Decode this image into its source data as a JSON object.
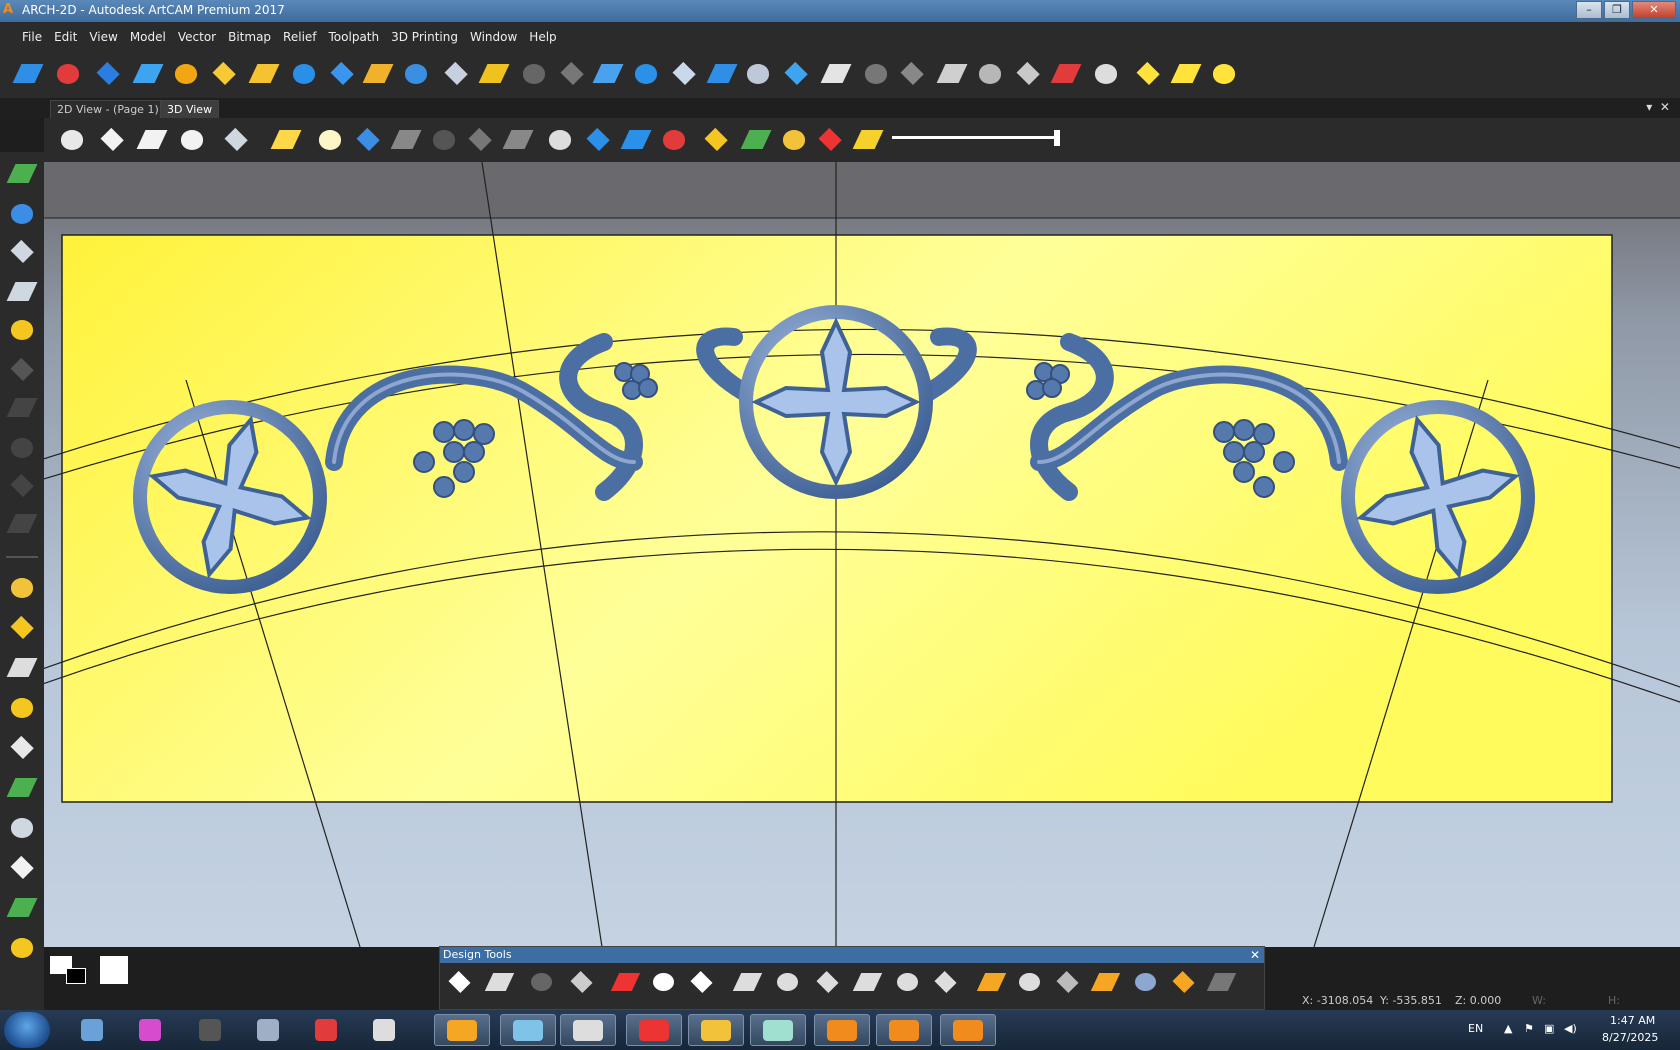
{
  "window": {
    "title": "ARCH-2D - Autodesk ArtCAM Premium 2017"
  },
  "menu": [
    "File",
    "Edit",
    "View",
    "Model",
    "Vector",
    "Bitmap",
    "Relief",
    "Toolpath",
    "3D Printing",
    "Window",
    "Help"
  ],
  "tabs": [
    {
      "label": "2D View -  (Page 1)",
      "active": false
    },
    {
      "label": "3D View",
      "active": true
    }
  ],
  "toolbar1_icons": [
    "plane-icon",
    "revolve-icon",
    "extrude-icon",
    "spin-icon",
    "weave-icon",
    "sculpt-icon",
    "import-folder-icon",
    "flat-relief-icon",
    "split-relief-icon",
    "texture-icon",
    "raise-icon",
    "merge-icon",
    "peak-icon",
    "smooth-icon",
    "dots-icon",
    "fade-icon",
    "layers-icon",
    "offset-icon",
    "blend-icon",
    "distort-icon",
    "stack-icon",
    "eraser-icon",
    "tilt-icon",
    "colors-grid-icon",
    "scale-icon",
    "mirror-icon",
    "tiles-icon",
    "flag-icon",
    "cross-section-icon",
    "node-icon",
    "wave-icon",
    "polyline-icon"
  ],
  "toolbar2_icons": [
    "view-iso-red-icon",
    "view-front-icon",
    "view-side-icon",
    "view-top-icon",
    "zoom-icon",
    "light-icon",
    "material-icon",
    "axes-icon",
    "puzzle-icon",
    "cylinder-icon",
    "solid-icon",
    "machine-icon",
    "clock-icon",
    "star-icon",
    "layer-blue-icon",
    "layer-red-icon",
    "yellow-plane-icon",
    "green-shapes-icon",
    "search-star-icon",
    "color-cube-icon",
    "rainbow-icon"
  ],
  "left_icons": [
    "add-icon",
    "bucket-icon",
    "target-icon",
    "curve-icon",
    "mirror-relief-icon",
    "square-icon",
    "dim-1-icon",
    "dim-2-icon",
    "dim-3-icon",
    "dim-4-icon",
    "folder-star-icon",
    "vector-icon",
    "magic-icon",
    "spiral-icon",
    "asterisk-icon",
    "lift-icon",
    "fold-icon",
    "frame-icon",
    "grid-green-icon",
    "plate-icon"
  ],
  "design_tools": {
    "title": "Design Tools",
    "icons": [
      "select-icon",
      "node-edit-icon",
      "transform-icon",
      "distort-grid-icon",
      "pencil-icon",
      "fill-icon",
      "measure-icon",
      "polyline-tool-icon",
      "rectangle-icon",
      "circle-icon",
      "polygon-icon",
      "arc-icon",
      "text-icon",
      "drop-icon",
      "hand-icon",
      "knife-icon",
      "brush-icon",
      "eraser-tool-icon",
      "smudge-icon",
      "feather-icon"
    ]
  },
  "status": {
    "x": "X: -3108.054",
    "y": "Y: -535.851",
    "z": "Z: 0.000",
    "w": "W:",
    "h": "H:"
  },
  "taskbar": {
    "apps": [
      "explorer-icon",
      "paint-icon",
      "artcam-a-icon",
      "calculator-icon",
      "huawei-icon",
      "rhino-icon",
      "media-icon",
      "palette-icon",
      "zbrush-icon",
      "yandex-icon",
      "files-icon",
      "glass-icon",
      "artcam-icon",
      "artcam2-icon",
      "pdf-icon"
    ],
    "lang": "EN",
    "time": "1:47 AM",
    "date": "8/27/2025"
  },
  "colors": {
    "background": "#1e1e1e",
    "panel": "#2b2b2b",
    "title_blue": "#3c6ea3",
    "model_yellow": "#ffff66",
    "relief_blue": "#5678a8"
  }
}
